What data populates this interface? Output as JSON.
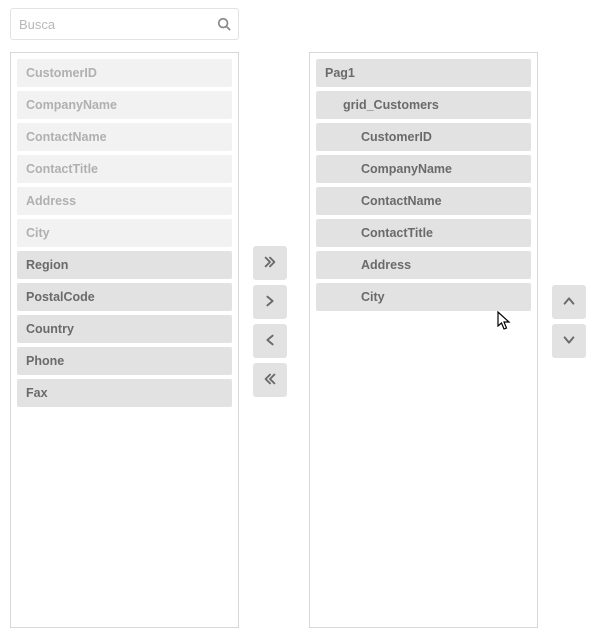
{
  "search": {
    "placeholder": "Busca",
    "value": ""
  },
  "left_items": [
    {
      "label": "CustomerID",
      "dim": true
    },
    {
      "label": "CompanyName",
      "dim": true
    },
    {
      "label": "ContactName",
      "dim": true
    },
    {
      "label": "ContactTitle",
      "dim": true
    },
    {
      "label": "Address",
      "dim": true
    },
    {
      "label": "City",
      "dim": true
    },
    {
      "label": "Region",
      "dim": false
    },
    {
      "label": "PostalCode",
      "dim": false
    },
    {
      "label": "Country",
      "dim": false
    },
    {
      "label": "Phone",
      "dim": false
    },
    {
      "label": "Fax",
      "dim": false
    }
  ],
  "right_items": [
    {
      "label": "Pag1",
      "indent": 0
    },
    {
      "label": "grid_Customers",
      "indent": 1
    },
    {
      "label": "CustomerID",
      "indent": 2
    },
    {
      "label": "CompanyName",
      "indent": 2
    },
    {
      "label": "ContactName",
      "indent": 2
    },
    {
      "label": "ContactTitle",
      "indent": 2
    },
    {
      "label": "Address",
      "indent": 2
    },
    {
      "label": "City",
      "indent": 2
    }
  ],
  "icons": {
    "search": "search-icon",
    "add_all": "angles-right-icon",
    "add_one": "angle-right-icon",
    "remove_one": "angle-left-icon",
    "remove_all": "angles-left-icon",
    "up": "angle-up-icon",
    "down": "angle-down-icon"
  }
}
